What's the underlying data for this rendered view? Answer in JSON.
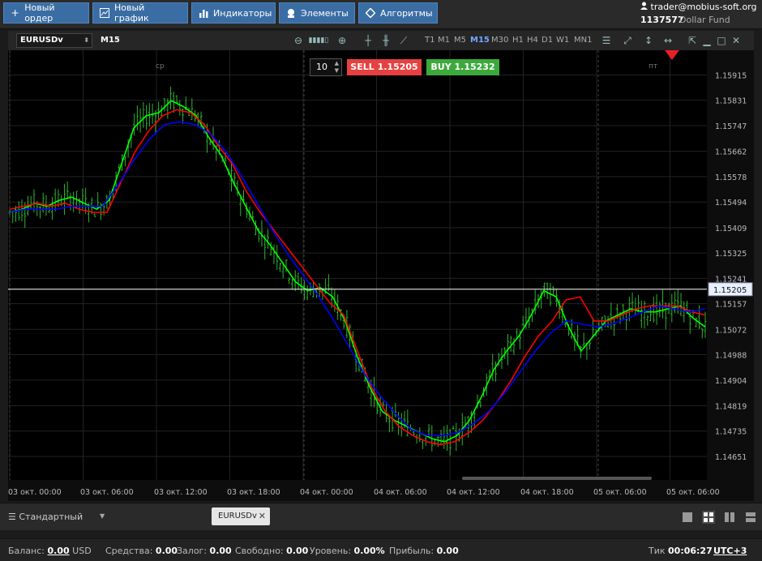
{
  "toolbar": {
    "new_order": "Новый ордер",
    "new_chart": "Новый график",
    "indicators": "Индикаторы",
    "elements": "Элементы",
    "algorithms": "Алгоритмы"
  },
  "account": {
    "email": "trader@mobius-soft.org",
    "number": "1137577",
    "fund": "Dollar Fund"
  },
  "chart_header": {
    "symbol": "EURUSDv",
    "timeframe": "M15",
    "timeframes": [
      "T1",
      "M1",
      "M5",
      "M15",
      "M30",
      "H1",
      "H4",
      "D1",
      "W1",
      "MN1"
    ],
    "active_timeframe": "M15"
  },
  "order_panel": {
    "quantity": "10",
    "sell_label": "SELL 1.15205",
    "buy_label": "BUY 1.15232"
  },
  "chart": {
    "day_labels": [
      "ср",
      "пт"
    ],
    "current_price_label": "1.15205",
    "colors": {
      "candles": "#2db52d",
      "ma_fast": "#00ff00",
      "ma_mid": "#ff0000",
      "ma_slow": "#0000ff",
      "price_line": "#ffffff"
    }
  },
  "chart_data": {
    "type": "line",
    "x_ticks": [
      "03 окт. 00:00",
      "03 окт. 06:00",
      "03 окт. 12:00",
      "03 окт. 18:00",
      "04 окт. 00:00",
      "04 окт. 06:00",
      "04 окт. 12:00",
      "04 окт. 18:00",
      "05 окт. 06:00",
      "05 окт. 06:00"
    ],
    "y_ticks": [
      "1.15915",
      "1.15831",
      "1.15747",
      "1.15662",
      "1.15578",
      "1.15494",
      "1.15409",
      "1.15325",
      "1.15241",
      "1.15157",
      "1.15072",
      "1.14988",
      "1.14904",
      "1.14819",
      "1.14735",
      "1.14651"
    ],
    "ylim": [
      1.146,
      1.1597
    ],
    "current_price": 1.15205,
    "series": [
      {
        "name": "",
        "color": "#00ff00",
        "values": [
          1.1546,
          1.1547,
          1.1549,
          1.1548,
          1.155,
          1.1551,
          1.1549,
          1.1547,
          1.155,
          1.1562,
          1.1574,
          1.1578,
          1.1579,
          1.1583,
          1.1581,
          1.1578,
          1.1571,
          1.1565,
          1.1556,
          1.1548,
          1.154,
          1.1535,
          1.1529,
          1.1523,
          1.152,
          1.1521,
          1.1518,
          1.151,
          1.1498,
          1.1488,
          1.148,
          1.1477,
          1.1475,
          1.1473,
          1.1471,
          1.147,
          1.1472,
          1.1477,
          1.1485,
          1.1494,
          1.15,
          1.1505,
          1.1512,
          1.152,
          1.1518,
          1.1508,
          1.15,
          1.1505,
          1.151,
          1.1512,
          1.1514,
          1.1513,
          1.1513,
          1.1514,
          1.1515,
          1.1511,
          1.1508
        ]
      },
      {
        "name": "",
        "color": "#ff0000",
        "values": [
          1.1547,
          1.1548,
          1.1549,
          1.1548,
          1.1549,
          1.1547,
          1.1546,
          1.1546,
          1.1556,
          1.1566,
          1.1573,
          1.1578,
          1.158,
          1.1579,
          1.1575,
          1.1568,
          1.1562,
          1.1553,
          1.1546,
          1.154,
          1.1534,
          1.1528,
          1.1522,
          1.1516,
          1.1512,
          1.15,
          1.1488,
          1.148,
          1.1475,
          1.1472,
          1.147,
          1.1469,
          1.147,
          1.1473,
          1.1477,
          1.1483,
          1.149,
          1.1498,
          1.1505,
          1.151,
          1.1517,
          1.1518,
          1.151,
          1.151,
          1.1512,
          1.1514,
          1.1515,
          1.1515,
          1.1515,
          1.1513,
          1.1512
        ]
      },
      {
        "name": "",
        "color": "#0000ff",
        "values": [
          1.1546,
          1.1547,
          1.1547,
          1.1547,
          1.1548,
          1.1548,
          1.1548,
          1.1555,
          1.1563,
          1.157,
          1.1575,
          1.1576,
          1.1575,
          1.1572,
          1.1566,
          1.1558,
          1.1549,
          1.154,
          1.1532,
          1.1525,
          1.1518,
          1.151,
          1.1501,
          1.1492,
          1.1485,
          1.1479,
          1.1474,
          1.1472,
          1.1472,
          1.1473,
          1.1476,
          1.148,
          1.1486,
          1.1493,
          1.15,
          1.1506,
          1.151,
          1.1509,
          1.1508,
          1.1509,
          1.1511,
          1.1513,
          1.1515,
          1.1514,
          1.1513,
          1.1514
        ]
      }
    ]
  },
  "bottom_tabs": {
    "profile": "Стандартный",
    "chart_tab": "EURUSDv"
  },
  "status": {
    "balance_label": "Баланс:",
    "balance_value": "0.00",
    "balance_currency": "USD",
    "funds_label": "Средства:",
    "funds_value": "0.00",
    "margin_label": "Залог:",
    "margin_value": "0.00",
    "free_label": "Свободно:",
    "free_value": "0.00",
    "level_label": "Уровень:",
    "level_value": "0.00%",
    "profit_label": "Прибыль:",
    "profit_value": "0.00",
    "tick_label": "Тик",
    "tick_value": "00:06:27",
    "timezone": "UTC+3"
  }
}
